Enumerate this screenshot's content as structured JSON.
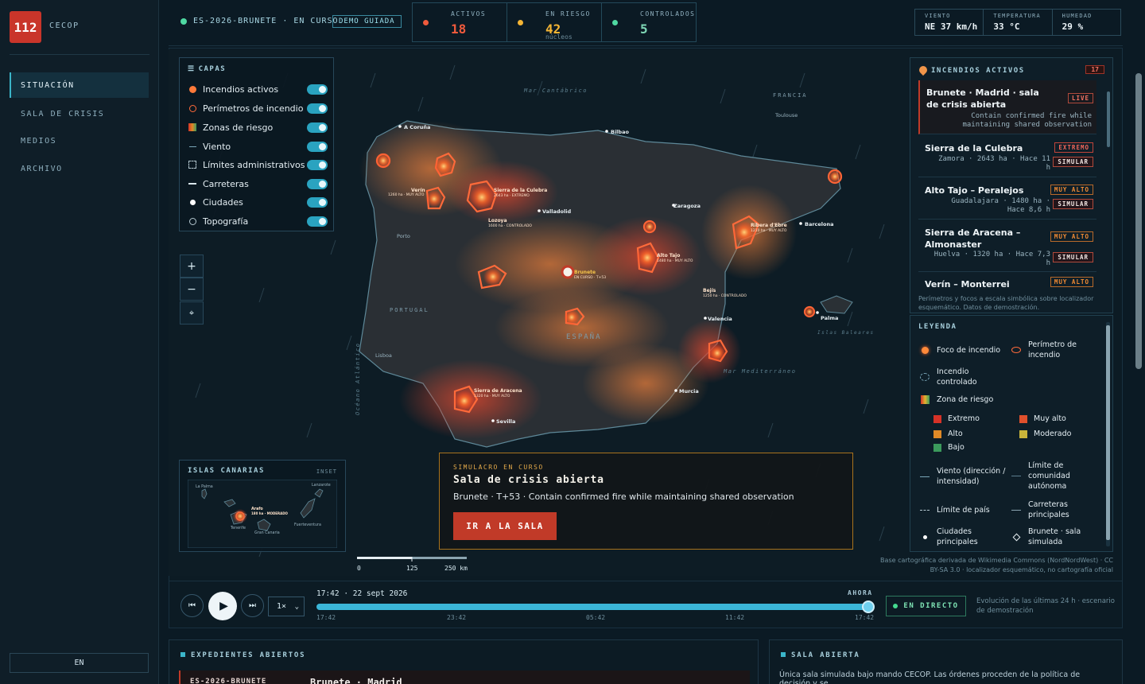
{
  "sidebar": {
    "logo": "112",
    "org": "CECOP",
    "items": [
      {
        "label": "SITUACIÓN",
        "active": true
      },
      {
        "label": "SALA DE CRISIS"
      },
      {
        "label": "MEDIOS"
      },
      {
        "label": "ARCHIVO"
      }
    ],
    "lang": "EN"
  },
  "header": {
    "incident": "ES-2026-BRUNETE · EN CURSO",
    "demo": "DEMO GUIADA",
    "stats": [
      {
        "label": "ACTIVOS",
        "value": "18",
        "sub": "",
        "color": "#f05a3c"
      },
      {
        "label": "EN RIESGO",
        "value": "42",
        "sub": "núcleos",
        "color": "#f5b534"
      },
      {
        "label": "CONTROLADOS",
        "value": "5",
        "sub": "",
        "color": "#4fd9a2"
      }
    ],
    "weather": [
      {
        "label": "VIENTO",
        "value": "NE 37 km/h"
      },
      {
        "label": "TEMPERATURA",
        "value": "33 °C"
      },
      {
        "label": "HUMEDAD",
        "value": "29 %"
      }
    ]
  },
  "layers": {
    "title": "CAPAS",
    "items": [
      {
        "label": "Incendios activos",
        "icon": "fire-dot",
        "on": true
      },
      {
        "label": "Perímetros de incendio",
        "icon": "perimeter-ring",
        "on": true
      },
      {
        "label": "Zonas de riesgo",
        "icon": "risk-gradient",
        "on": true
      },
      {
        "label": "Viento",
        "icon": "wind-arrow",
        "on": true
      },
      {
        "label": "Límites administrativos",
        "icon": "dashed-square",
        "on": true
      },
      {
        "label": "Carreteras",
        "icon": "road-line",
        "on": true
      },
      {
        "label": "Ciudades",
        "icon": "city-dot",
        "on": true
      },
      {
        "label": "Topografía",
        "icon": "topo-ring",
        "on": true
      }
    ]
  },
  "zoom": {
    "in": "+",
    "out": "−",
    "north": "⌖"
  },
  "map": {
    "seas": {
      "cantabrico": "Mar Cantábrico",
      "atlantico": "Océano Atlántico",
      "mediterraneo": "Mar Mediterráneo",
      "baleares": "Islas Baleares"
    },
    "countries": {
      "francia": "FRANCIA",
      "portugal": "PORTUGAL",
      "espana": "ESPAÑA"
    },
    "cities": [
      "A Coruña",
      "Bilbao",
      "Toulouse",
      "Porto",
      "Valladolid",
      "Zaragoza",
      "Barcelona",
      "Valencia",
      "Palma",
      "Lisboa",
      "Murcia",
      "Sevilla"
    ],
    "labels": [
      {
        "title": "Verín",
        "sub": "1260 ha · MUY ALTO"
      },
      {
        "title": "Sierra de la Culebra",
        "sub": "2643 ha · EXTREMO"
      },
      {
        "title": "Ribera d'Ebre",
        "sub": "1210 ha · MUY ALTO"
      },
      {
        "title": "Alto Tajo",
        "sub": "1480 ha · MUY ALTO"
      },
      {
        "title": "Sierra de Aracena",
        "sub": "1320 ha · MUY ALTO"
      },
      {
        "title": "Lozoya",
        "sub": "1600 ha · CONTROLADO"
      },
      {
        "title": "Brunete",
        "sub": "EN CURSO · T+53"
      },
      {
        "title": "Bejís",
        "sub": "1250 ha · CONTROLADO"
      }
    ]
  },
  "canary": {
    "title": "ISLAS CANARIAS",
    "tag": "INSET",
    "islands": [
      "La Palma",
      "Lanzarote",
      "Tenerife",
      "Gran Canaria",
      "Fuerteventura"
    ],
    "fire": {
      "title": "Arafo",
      "sub": "180 ha · MODERADO"
    }
  },
  "simulacro": {
    "kicker": "SIMULACRO EN CURSO",
    "title": "Sala de crisis abierta",
    "desc": "Brunete · T+53 · Contain confirmed fire while maintaining shared observation",
    "button": "IR A LA SALA"
  },
  "fires": {
    "title": "INCENDIOS ACTIVOS",
    "count": "17",
    "list": [
      {
        "name": "Brunete · Madrid · sala de crisis abierta",
        "meta": "Contain confirmed fire while maintaining shared observation",
        "severity": "LIVE",
        "color": "#e6564a",
        "live": true
      },
      {
        "name": "Sierra de la Culebra",
        "meta": "Zamora · 2643 ha · Hace 11 h",
        "severity": "EXTREMO",
        "color": "#e6564a",
        "action": "SIMULAR"
      },
      {
        "name": "Alto Tajo – Peralejos",
        "meta": "Guadalajara · 1480 ha · Hace 8,6 h",
        "severity": "MUY ALTO",
        "color": "#f08a33",
        "action": "SIMULAR"
      },
      {
        "name": "Sierra de Aracena – Almonaster",
        "meta": "Huelva · 1320 ha · Hace 7,3 h",
        "severity": "MUY ALTO",
        "color": "#f08a33",
        "action": "SIMULAR"
      },
      {
        "name": "Verín – Monterrei",
        "meta": "",
        "severity": "MUY ALTO",
        "color": "#f08a33"
      }
    ],
    "note": "Perímetros y focos a escala simbólica sobre localizador esquemático. Datos de demostración."
  },
  "legend": {
    "title": "LEYENDA",
    "items": {
      "focus": "Foco de incendio",
      "perimeter": "Perímetro de incendio",
      "controlled": "Incendio controlado",
      "risk": "Zona de riesgo",
      "extremo": "Extremo",
      "muy_alto": "Muy alto",
      "alto": "Alto",
      "moderado": "Moderado",
      "bajo": "Bajo",
      "wind": "Viento (dirección / intensidad)",
      "community": "Límite de comunidad autónoma",
      "country": "Límite de país",
      "roads": "Carreteras principales",
      "cities": "Ciudades principales",
      "brunete": "Brunete · sala simulada"
    },
    "colors": {
      "extremo": "#d63227",
      "muy_alto": "#e0502c",
      "alto": "#e08a27",
      "moderado": "#c9b43a",
      "bajo": "#3b9a5c"
    }
  },
  "credit": "Base cartográfica derivada de Wikimedia Commons (NordNordWest) · CC BY-SA 3.0 · localizador esquemático, no cartografía oficial",
  "scale": [
    "0",
    "125",
    "250 km"
  ],
  "timeline": {
    "timestamp": "17:42 · 22 sept 2026",
    "now": "AHORA",
    "ticks": [
      "17:42",
      "23:42",
      "05:42",
      "11:42",
      "17:42"
    ],
    "speed": "1×",
    "progress": 1.0,
    "live": "EN DIRECTO",
    "evolution": "Evolución de las últimas 24 h · escenario de demostración"
  },
  "bottom": {
    "expedientes": "EXPEDIENTES ABIERTOS",
    "exp_id": "ES-2026-BRUNETE",
    "exp_title": "Brunete · Madrid",
    "sala": "SALA ABIERTA",
    "sala_text": "Única sala simulada bajo mando CECOP. Las órdenes proceden de la política de decisión y se"
  }
}
